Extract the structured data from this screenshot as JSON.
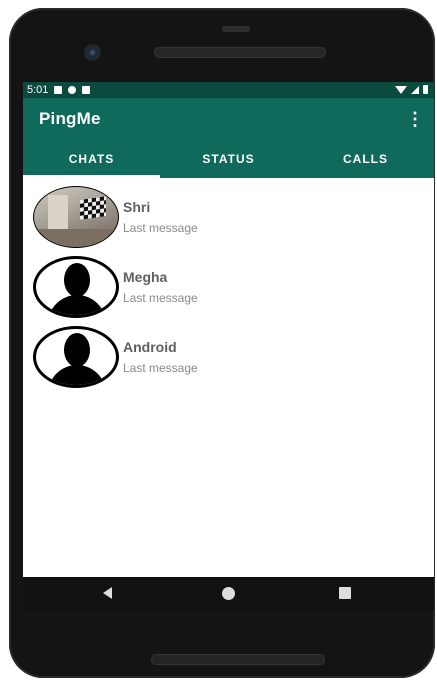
{
  "status_bar": {
    "time": "5:01"
  },
  "app_bar": {
    "title": "PingMe",
    "overflow_icon": "more-vert-icon"
  },
  "tabs": [
    {
      "label": "CHATS",
      "active": true
    },
    {
      "label": "STATUS",
      "active": false
    },
    {
      "label": "CALLS",
      "active": false
    }
  ],
  "chats": [
    {
      "name": "Shri",
      "subtitle": "Last message",
      "avatar": "photo"
    },
    {
      "name": "Megha",
      "subtitle": "Last message",
      "avatar": "default-person-icon"
    },
    {
      "name": "Android",
      "subtitle": "Last message",
      "avatar": "default-person-icon"
    }
  ],
  "colors": {
    "primary": "#0f6a5b",
    "status_bar": "#0b4a3f"
  }
}
